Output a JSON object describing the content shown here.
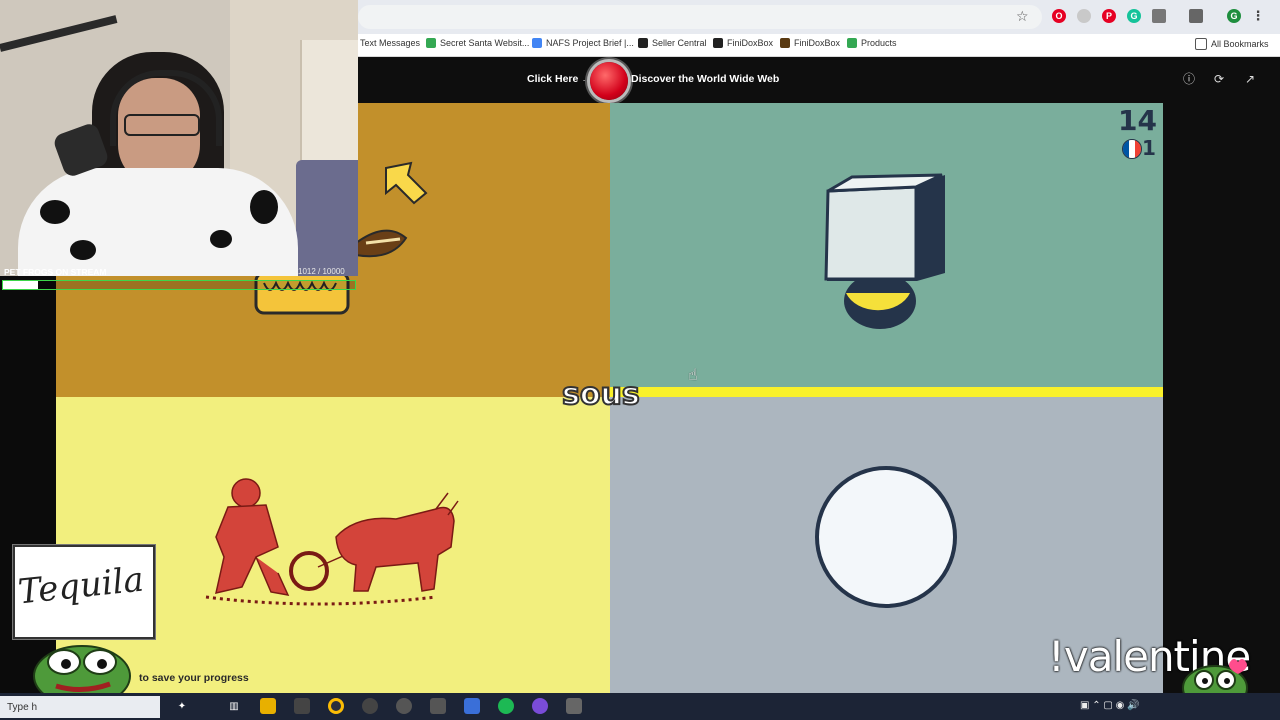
{
  "browser": {
    "bookmarks": [
      {
        "label": "Text Messages",
        "color": "#ffffff"
      },
      {
        "label": "Secret Santa Websit...",
        "color": "#34a853"
      },
      {
        "label": "NAFS Project Brief |...",
        "color": "#4285f4"
      },
      {
        "label": "Seller Central",
        "color": "#222222"
      },
      {
        "label": "FiniDoxBox",
        "color": "#222222"
      },
      {
        "label": "FiniDoxBox",
        "color": "#5a3a12"
      },
      {
        "label": "Products",
        "color": "#34a853"
      }
    ],
    "all_bookmarks": "All Bookmarks",
    "profile_initial": "G"
  },
  "header": {
    "cta_left": "Click Here →",
    "cta_right": "Discover the World Wide Web"
  },
  "game": {
    "word": "sous",
    "score": "14",
    "lives": "1",
    "language_flag": [
      "#0055a4",
      "#ffffff",
      "#ef4135"
    ],
    "panels": [
      "corn-and-arrow",
      "box-over-ball",
      "plowing-farmer",
      "white-circle"
    ]
  },
  "overlay": {
    "stream_title": "PET FROGS ON STREAM",
    "goal_counter": "1012 / 10000",
    "goal_fraction": 0.1,
    "tequila": "Tequila",
    "save_progress": "to save your progress",
    "command": "!valentine"
  },
  "taskbar": {
    "search_label": "Type h"
  },
  "colors": {
    "tl_panel": "#c2902b",
    "tr_panel": "#7aae9c",
    "bl_panel": "#f2ef7e",
    "br_panel": "#acb6bf",
    "highlight_bar": "#f9f12b"
  }
}
